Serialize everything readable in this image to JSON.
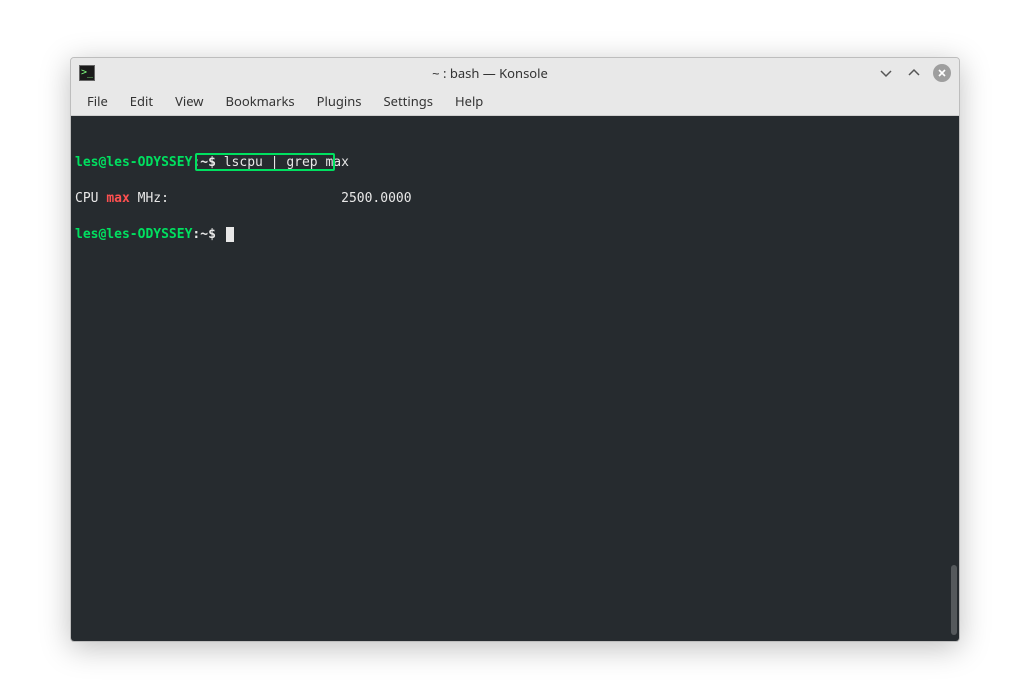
{
  "window": {
    "title": "~ : bash — Konsole",
    "icon": "terminal-icon"
  },
  "menubar": {
    "items": [
      {
        "label": "File"
      },
      {
        "label": "Edit"
      },
      {
        "label": "View"
      },
      {
        "label": "Bookmarks"
      },
      {
        "label": "Plugins"
      },
      {
        "label": "Settings"
      },
      {
        "label": "Help"
      }
    ]
  },
  "terminal": {
    "prompt_user": "les@les-ODYSSEY",
    "prompt_sep": ":",
    "prompt_path": "~",
    "prompt_dollar": "$",
    "command": "lscpu | grep max",
    "output_prefix": "CPU ",
    "output_match": "max",
    "output_suffix": " MHz:",
    "output_value_padding": "                      ",
    "output_value": "2500.0000"
  },
  "colors": {
    "terminal_bg": "#262b2f",
    "prompt_green": "#00e060",
    "text": "#e8e8e8",
    "grep_match": "#ff5050",
    "chrome_bg": "#e8e8e8"
  }
}
